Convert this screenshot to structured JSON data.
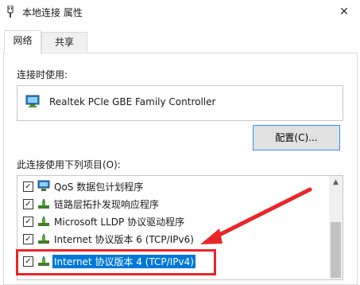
{
  "window": {
    "title": "本地连接 属性",
    "close_symbol": "✕"
  },
  "tabs": [
    {
      "label": "网络",
      "active": true
    },
    {
      "label": "共享",
      "active": false
    }
  ],
  "connect_using": {
    "label": "连接时使用:",
    "adapter": "Realtek PCIe GBE Family Controller"
  },
  "config_button": {
    "label": "配置(C)..."
  },
  "items_section": {
    "label": "此连接使用下列项目(O):",
    "items": [
      {
        "label": "QoS 数据包计划程序",
        "checked": true,
        "icon": "qos-icon",
        "selected": false
      },
      {
        "label": "链路层拓扑发现响应程序",
        "checked": true,
        "icon": "network-protocol-icon",
        "selected": false
      },
      {
        "label": "Microsoft LLDP 协议驱动程序",
        "checked": true,
        "icon": "network-protocol-icon",
        "selected": false
      },
      {
        "label": "Internet 协议版本 6 (TCP/IPv6)",
        "checked": true,
        "icon": "network-protocol-icon",
        "selected": false
      },
      {
        "label": "Internet 协议版本 4 (TCP/IPv4)",
        "checked": true,
        "icon": "network-protocol-icon",
        "selected": true
      }
    ]
  },
  "colors": {
    "selection": "#0078d7",
    "annotation": "#e8262a"
  }
}
